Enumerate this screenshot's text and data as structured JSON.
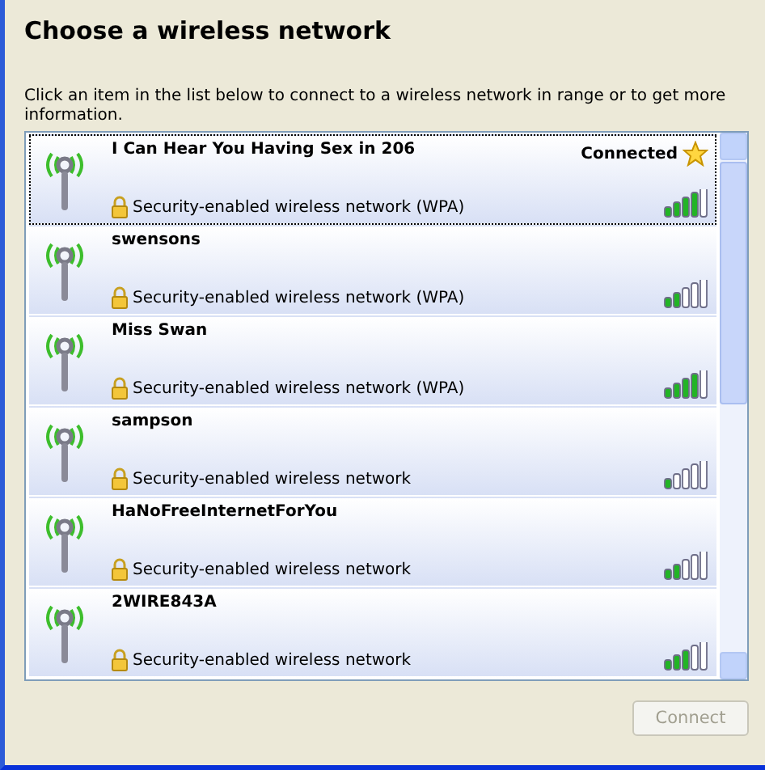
{
  "title": "Choose a wireless network",
  "instructions": "Click an item in the list below to connect to a wireless network in range or to get more information.",
  "networks": [
    {
      "name": "I Can Hear You Having Sex in 206",
      "security": "Security-enabled wireless network (WPA)",
      "status": "Connected",
      "starred": true,
      "selected": true,
      "level": 0.8
    },
    {
      "name": "swensons",
      "security": "Security-enabled wireless network (WPA)",
      "starred": false,
      "selected": false,
      "level": 0.4
    },
    {
      "name": "Miss Swan",
      "security": "Security-enabled wireless network (WPA)",
      "starred": false,
      "selected": false,
      "level": 0.8
    },
    {
      "name": "sampson",
      "security": "Security-enabled wireless network",
      "starred": false,
      "selected": false,
      "level": 0.2
    },
    {
      "name": "HaNoFreeInternetForYou",
      "security": "Security-enabled wireless network",
      "starred": false,
      "selected": false,
      "level": 0.4
    },
    {
      "name": "2WIRE843A",
      "security": "Security-enabled wireless network",
      "starred": false,
      "selected": false,
      "level": 0.6
    }
  ],
  "connect_button": {
    "label": "Connect",
    "disabled": true
  }
}
